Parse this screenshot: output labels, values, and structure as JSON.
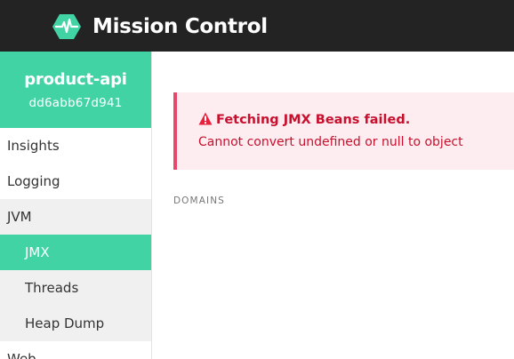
{
  "header": {
    "title": "Mission Control",
    "logo_icon": "heartbeat-icon",
    "accent": "#42d3a5",
    "background": "#232323"
  },
  "app": {
    "name": "product-api",
    "instance_id": "dd6abb67d941"
  },
  "sidebar": {
    "items": [
      {
        "label": "Insights"
      },
      {
        "label": "Logging"
      },
      {
        "label": "JVM"
      },
      {
        "label": "JMX"
      },
      {
        "label": "Threads"
      },
      {
        "label": "Heap Dump"
      },
      {
        "label": "Web"
      }
    ],
    "active_item": "JMX",
    "active_color": "#42d3a5"
  },
  "alert": {
    "icon": "warning-icon",
    "title": "Fetching JMX Beans failed.",
    "message": "Cannot convert undefined or null to object",
    "color": "#c8102e"
  },
  "main": {
    "domains_label": "DOMAINS"
  }
}
